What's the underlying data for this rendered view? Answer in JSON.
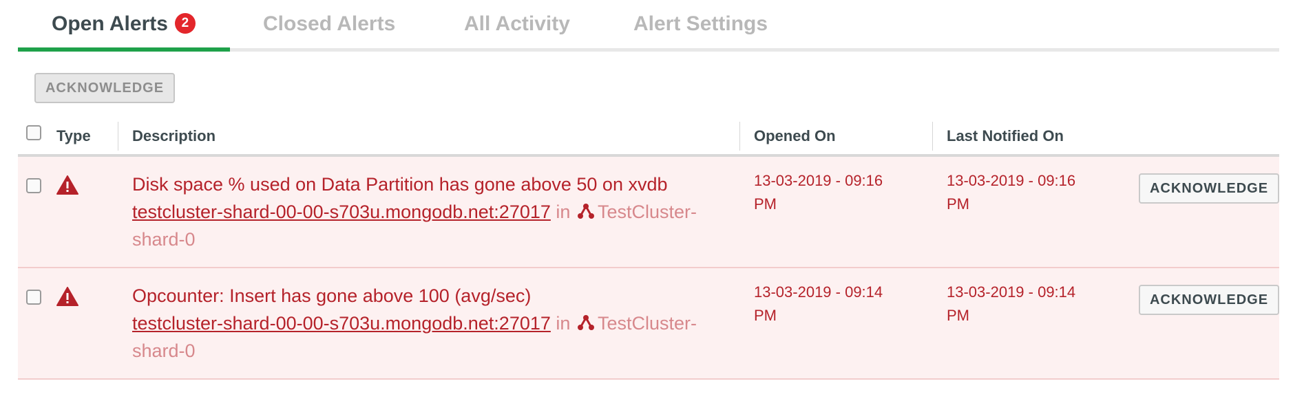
{
  "tabs": [
    {
      "label": "Open Alerts",
      "badge": "2",
      "active": true
    },
    {
      "label": "Closed Alerts"
    },
    {
      "label": "All Activity"
    },
    {
      "label": "Alert Settings"
    }
  ],
  "toolbar": {
    "acknowledge_label": "ACKNOWLEDGE"
  },
  "table": {
    "headers": {
      "type": "Type",
      "description": "Description",
      "opened_on": "Opened On",
      "last_notified_on": "Last Notified On"
    },
    "rows": [
      {
        "description": "Disk space % used on Data Partition has gone above 50 on xvdb",
        "host": "testcluster-shard-00-00-s703u.mongodb.net:27017",
        "in": "in",
        "cluster_line1": "TestCluster-",
        "cluster_line2": "shard-0",
        "opened_line1": "13-03-2019 - 09:16",
        "opened_line2": "PM",
        "notified_line1": "13-03-2019 - 09:16",
        "notified_line2": "PM",
        "action": "ACKNOWLEDGE"
      },
      {
        "description": "Opcounter: Insert has gone above 100 (avg/sec)",
        "host": "testcluster-shard-00-00-s703u.mongodb.net:27017",
        "in": "in",
        "cluster_line1": "TestCluster-",
        "cluster_line2": "shard-0",
        "opened_line1": "13-03-2019 - 09:14",
        "opened_line2": "PM",
        "notified_line1": "13-03-2019 - 09:14",
        "notified_line2": "PM",
        "action": "ACKNOWLEDGE"
      }
    ]
  },
  "colors": {
    "accent_tab": "#1fa14a",
    "badge": "#e3262b",
    "alert_text": "#b5222a",
    "row_bg": "#fdf1f1"
  },
  "icons": {
    "row_type": "warning-triangle-icon",
    "cluster": "replica-set-icon"
  }
}
